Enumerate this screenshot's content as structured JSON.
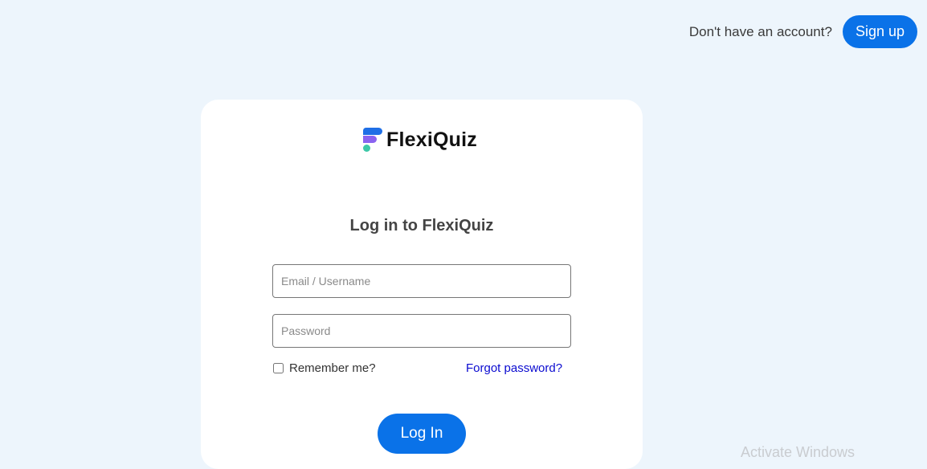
{
  "header": {
    "account_prompt": "Don't have an account?",
    "signup_label": "Sign up"
  },
  "brand": {
    "name": "FlexiQuiz",
    "colors": {
      "primary": "#0a72e8",
      "logo_blue": "#1f6fe6",
      "logo_purple": "#8a63f0",
      "logo_teal": "#3dc8a8",
      "background": "#edf5fc"
    }
  },
  "login": {
    "title": "Log in to FlexiQuiz",
    "email_placeholder": "Email / Username",
    "email_value": "",
    "password_placeholder": "Password",
    "password_value": "",
    "remember_label": "Remember me?",
    "remember_checked": false,
    "forgot_label": "Forgot password?",
    "submit_label": "Log In"
  },
  "system": {
    "watermark": "Activate Windows"
  }
}
